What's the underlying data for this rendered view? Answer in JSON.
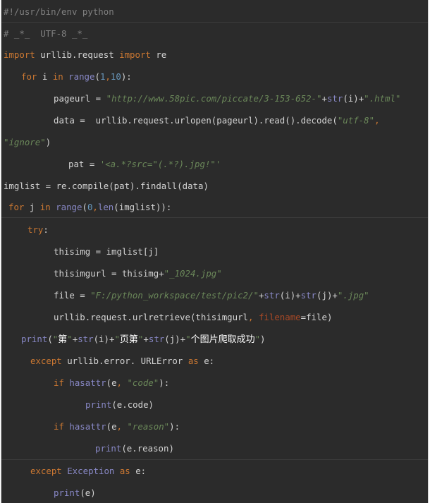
{
  "code": {
    "lines": [
      [
        {
          "t": "#!/usr/bin/env python",
          "c": "cmt"
        }
      ],
      [
        {
          "t": "# _*_  UTF-8 _*_",
          "c": "cmt"
        }
      ],
      [
        {
          "t": "import",
          "c": "kw"
        },
        {
          "t": " urllib.request ",
          "c": "txt"
        },
        {
          "t": "import",
          "c": "kw"
        },
        {
          "t": " re",
          "c": "txt"
        }
      ],
      [
        {
          "t": "for",
          "c": "kw"
        },
        {
          "t": " i ",
          "c": "txt"
        },
        {
          "t": "in",
          "c": "kw"
        },
        {
          "t": " ",
          "c": "txt"
        },
        {
          "t": "range",
          "c": "bi"
        },
        {
          "t": "(",
          "c": "txt"
        },
        {
          "t": "1",
          "c": "num"
        },
        {
          "t": ",",
          "c": "kw"
        },
        {
          "t": "10",
          "c": "num"
        },
        {
          "t": "):",
          "c": "txt"
        }
      ],
      [
        {
          "t": "pageurl = ",
          "c": "txt"
        },
        {
          "t": "\"http://www.58pic.com/piccate/3-153-652-\"",
          "c": "str"
        },
        {
          "t": "+",
          "c": "txt"
        },
        {
          "t": "str",
          "c": "bi"
        },
        {
          "t": "(i)+",
          "c": "txt"
        },
        {
          "t": "\".html\"",
          "c": "str"
        }
      ],
      [
        {
          "t": "data =  urllib.request.urlopen(pageurl).read().decode(",
          "c": "txt"
        },
        {
          "t": "\"utf-8\"",
          "c": "str"
        },
        {
          "t": ",",
          "c": "kw"
        }
      ],
      [
        {
          "t": "\"ignore\"",
          "c": "str"
        },
        {
          "t": ")",
          "c": "txt"
        }
      ],
      [
        {
          "t": "pat = ",
          "c": "txt"
        },
        {
          "t": "'<a.*?src=\"(.*?).jpg!\"'",
          "c": "str"
        }
      ],
      [
        {
          "t": "imglist = re.compile(pat).findall(data)",
          "c": "txt"
        }
      ],
      [
        {
          "t": "for",
          "c": "kw"
        },
        {
          "t": " j ",
          "c": "txt"
        },
        {
          "t": "in",
          "c": "kw"
        },
        {
          "t": " ",
          "c": "txt"
        },
        {
          "t": "range",
          "c": "bi"
        },
        {
          "t": "(",
          "c": "txt"
        },
        {
          "t": "0",
          "c": "num"
        },
        {
          "t": ",",
          "c": "kw"
        },
        {
          "t": "len",
          "c": "bi"
        },
        {
          "t": "(imglist)):",
          "c": "txt"
        }
      ],
      [
        {
          "t": "try",
          "c": "kw"
        },
        {
          "t": ":",
          "c": "txt"
        }
      ],
      [
        {
          "t": "thisimg = imglist[j]",
          "c": "txt"
        }
      ],
      [
        {
          "t": "thisimgurl = thisimg+",
          "c": "txt"
        },
        {
          "t": "\"_1024.jpg\"",
          "c": "str"
        }
      ],
      [
        {
          "t": "file = ",
          "c": "txt"
        },
        {
          "t": "\"F:/python_workspace/test/pic2/\"",
          "c": "str"
        },
        {
          "t": "+",
          "c": "txt"
        },
        {
          "t": "str",
          "c": "bi"
        },
        {
          "t": "(i)+",
          "c": "txt"
        },
        {
          "t": "str",
          "c": "bi"
        },
        {
          "t": "(j)+",
          "c": "txt"
        },
        {
          "t": "\".jpg\"",
          "c": "str"
        }
      ],
      [
        {
          "t": "urllib.request.urlretrieve(thisimgurl",
          "c": "txt"
        },
        {
          "t": ",",
          "c": "kw"
        },
        {
          "t": " ",
          "c": "txt"
        },
        {
          "t": "filename",
          "c": "named"
        },
        {
          "t": "=file)",
          "c": "txt"
        }
      ],
      [
        {
          "t": "print",
          "c": "bi"
        },
        {
          "t": "(",
          "c": "txt"
        },
        {
          "t": "\"",
          "c": "strq"
        },
        {
          "t": "第",
          "c": "cjk"
        },
        {
          "t": "\"",
          "c": "strq"
        },
        {
          "t": "+",
          "c": "txt"
        },
        {
          "t": "str",
          "c": "bi"
        },
        {
          "t": "(i)+",
          "c": "txt"
        },
        {
          "t": "\"",
          "c": "strq"
        },
        {
          "t": "页第",
          "c": "cjk"
        },
        {
          "t": "\"",
          "c": "strq"
        },
        {
          "t": "+",
          "c": "txt"
        },
        {
          "t": "str",
          "c": "bi"
        },
        {
          "t": "(j)+",
          "c": "txt"
        },
        {
          "t": "\"",
          "c": "strq"
        },
        {
          "t": "个图片爬取成功",
          "c": "cjk"
        },
        {
          "t": "\"",
          "c": "strq"
        },
        {
          "t": ")",
          "c": "txt"
        }
      ],
      [
        {
          "t": "except",
          "c": "kw"
        },
        {
          "t": " urllib.error. URLError ",
          "c": "txt"
        },
        {
          "t": "as",
          "c": "kw"
        },
        {
          "t": " e:",
          "c": "txt"
        }
      ],
      [
        {
          "t": "if",
          "c": "kw"
        },
        {
          "t": " ",
          "c": "txt"
        },
        {
          "t": "hasattr",
          "c": "bi"
        },
        {
          "t": "(e",
          "c": "txt"
        },
        {
          "t": ",",
          "c": "kw"
        },
        {
          "t": " ",
          "c": "txt"
        },
        {
          "t": "\"code\"",
          "c": "str"
        },
        {
          "t": "):",
          "c": "txt"
        }
      ],
      [
        {
          "t": "print",
          "c": "bi"
        },
        {
          "t": "(e.code)",
          "c": "txt"
        }
      ],
      [
        {
          "t": "if",
          "c": "kw"
        },
        {
          "t": " ",
          "c": "txt"
        },
        {
          "t": "hasattr",
          "c": "bi"
        },
        {
          "t": "(e",
          "c": "txt"
        },
        {
          "t": ",",
          "c": "kw"
        },
        {
          "t": " ",
          "c": "txt"
        },
        {
          "t": "\"reason\"",
          "c": "str"
        },
        {
          "t": "):",
          "c": "txt"
        }
      ],
      [
        {
          "t": "print",
          "c": "bi"
        },
        {
          "t": "(e.reason)",
          "c": "txt"
        }
      ],
      [
        {
          "t": "except",
          "c": "kw"
        },
        {
          "t": " Exception ",
          "c": "bi"
        },
        {
          "t": "as",
          "c": "kw"
        },
        {
          "t": " e:",
          "c": "txt"
        }
      ],
      [
        {
          "t": "print",
          "c": "bi"
        },
        {
          "t": "(e)",
          "c": "txt"
        }
      ]
    ]
  }
}
